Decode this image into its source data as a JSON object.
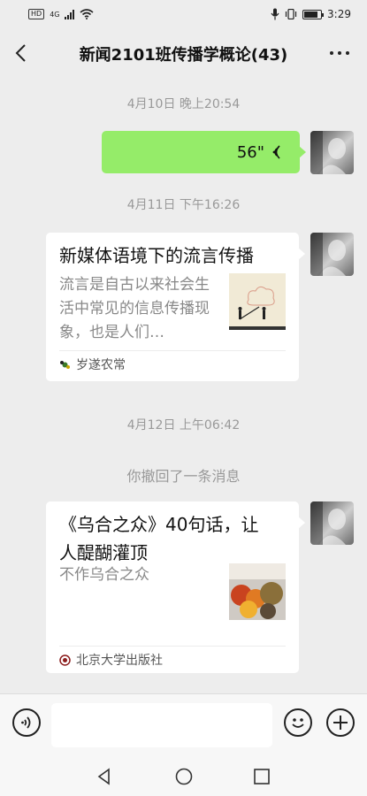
{
  "status_bar": {
    "network_badge": "HD",
    "network_type": "4G",
    "time": "3:29",
    "battery_level": 0.85
  },
  "header": {
    "title": "新闻2101班传播学概论(43)",
    "back_icon": "chevron-left-icon",
    "more_icon": "more-dots-icon"
  },
  "messages": [
    {
      "type": "timestamp",
      "text": "4月10日 晚上20:54"
    },
    {
      "type": "voice",
      "sender": "me",
      "duration": "56\""
    },
    {
      "type": "timestamp",
      "text": "4月11日 下午16:26"
    },
    {
      "type": "article",
      "sender": "me",
      "title": "新媒体语境下的流言传播",
      "desc": "流言是自古以来社会生活中常见的信息传播现象，也是人们…",
      "source": "岁遂农常"
    },
    {
      "type": "timestamp",
      "text": "4月12日 上午06:42"
    },
    {
      "type": "system",
      "text": "你撤回了一条消息"
    },
    {
      "type": "article",
      "sender": "me",
      "title": "《乌合之众》40句话，让人醍醐灌顶",
      "desc": "不作乌合之众",
      "source": "北京大学出版社"
    }
  ],
  "input_bar": {
    "voice_icon": "voice-mode-icon",
    "emoji_icon": "emoji-icon",
    "plus_icon": "plus-icon"
  },
  "nav_bar": {
    "back_icon": "nav-back-icon",
    "home_icon": "nav-home-icon",
    "recents_icon": "nav-recents-icon"
  },
  "colors": {
    "bubble_green": "#95ec69",
    "background": "#ededed",
    "timestamp_gray": "#999999"
  }
}
